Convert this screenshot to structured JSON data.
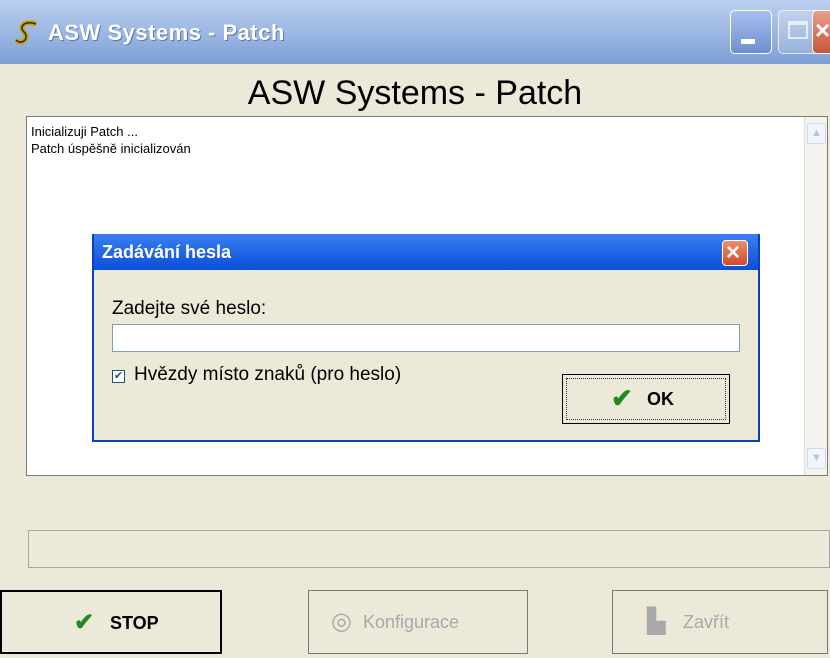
{
  "window": {
    "title": "ASW Systems  -  Patch",
    "heading": "ASW Systems  -  Patch",
    "app_icon": "s-logo-icon",
    "controls": [
      "minimize-icon",
      "maximize-icon",
      "close-icon"
    ]
  },
  "log": {
    "lines": [
      "Inicializuji Patch ...",
      "Patch úspěšně inicializován"
    ]
  },
  "dialog": {
    "title": "Zadávání hesla",
    "prompt": "Zadejte své heslo:",
    "password_value": "",
    "checkbox_label": "Hvězdy místo znaků (pro heslo)",
    "checkbox_checked": true,
    "ok_label": "OK"
  },
  "status": {
    "text": ""
  },
  "buttons": {
    "stop": "STOP",
    "konfigurace": "Konfigurace",
    "zavrit": "Zavřít"
  }
}
